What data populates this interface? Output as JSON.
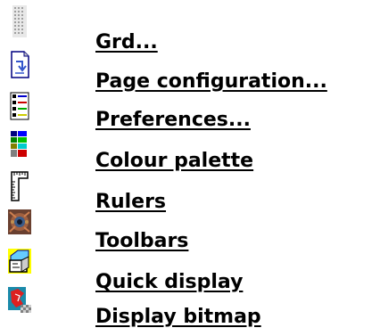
{
  "menu": {
    "items": [
      {
        "label": "Grd...",
        "icon": "grid-icon"
      },
      {
        "label": "Page configuration...",
        "icon": "page-config-icon"
      },
      {
        "label": "Preferences...",
        "icon": "preferences-icon"
      },
      {
        "label": "Colour palette",
        "icon": "colour-palette-icon"
      },
      {
        "label": "Rulers",
        "icon": "rulers-icon"
      },
      {
        "label": "Toolbars",
        "icon": "toolbars-icon"
      },
      {
        "label": "Quick display",
        "icon": "quick-display-icon"
      },
      {
        "label": "Display bitmap",
        "icon": "display-bitmap-icon"
      }
    ]
  }
}
